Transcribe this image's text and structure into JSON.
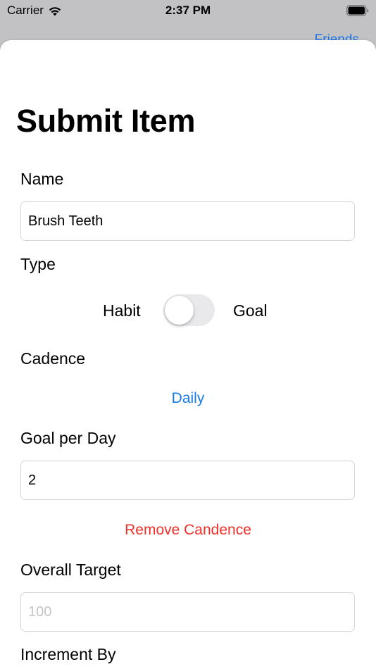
{
  "status_bar": {
    "carrier": "Carrier",
    "time": "2:37 PM"
  },
  "background_nav": {
    "friends_label": "Friends"
  },
  "form": {
    "title": "Submit Item",
    "name": {
      "label": "Name",
      "value": "Brush Teeth",
      "placeholder": ""
    },
    "type": {
      "label": "Type",
      "left_option": "Habit",
      "right_option": "Goal",
      "toggle_on": false
    },
    "cadence": {
      "label": "Cadence",
      "value": "Daily"
    },
    "goal_per_day": {
      "label": "Goal per Day",
      "value": "2",
      "placeholder": ""
    },
    "remove_cadence_label": "Remove Candence",
    "overall_target": {
      "label": "Overall Target",
      "value": "",
      "placeholder": "100"
    },
    "increment_by": {
      "label": "Increment By"
    }
  },
  "colors": {
    "link_blue": "#1a7ae6",
    "destructive_red": "#f0302a",
    "toggle_off_track": "#e9e9eb"
  }
}
